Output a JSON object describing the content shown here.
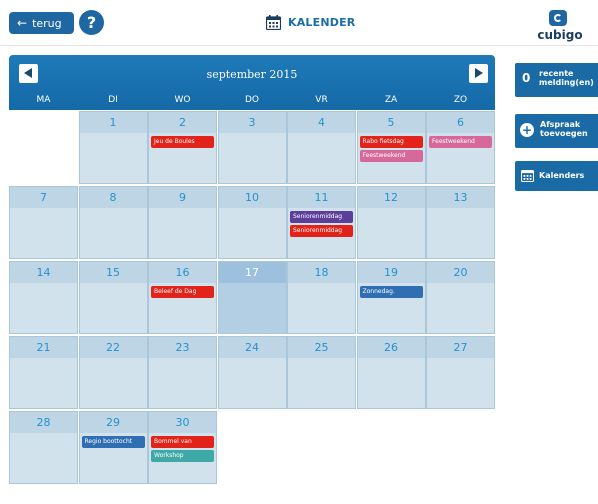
{
  "header": {
    "back_label": "terug",
    "help_label": "?",
    "title": "KALENDER",
    "logo_text": "cubigo"
  },
  "calendar": {
    "month_label": "september 2015",
    "day_names": [
      "MA",
      "DI",
      "WO",
      "DO",
      "VR",
      "ZA",
      "ZO"
    ],
    "today": 17,
    "weeks": [
      [
        null,
        {
          "day": 1
        },
        {
          "day": 2,
          "events": [
            {
              "label": "Jeu de Boules",
              "color": "#e2231a"
            }
          ]
        },
        {
          "day": 3
        },
        {
          "day": 4
        },
        {
          "day": 5,
          "events": [
            {
              "label": "Rabo fietsdag",
              "color": "#e2231a"
            },
            {
              "label": "Feestweekend",
              "color": "#d6699a"
            }
          ]
        },
        {
          "day": 6,
          "events": [
            {
              "label": "Feestweekend",
              "color": "#d6699a"
            }
          ]
        }
      ],
      [
        {
          "day": 7
        },
        {
          "day": 8
        },
        {
          "day": 9
        },
        {
          "day": 10
        },
        {
          "day": 11,
          "events": [
            {
              "label": "Seniorenmiddag",
              "color": "#5b3f9a"
            },
            {
              "label": "Seniorenmiddag",
              "color": "#e2231a"
            }
          ]
        },
        {
          "day": 12
        },
        {
          "day": 13
        }
      ],
      [
        {
          "day": 14
        },
        {
          "day": 15
        },
        {
          "day": 16,
          "events": [
            {
              "label": "Beleef de Dag",
              "color": "#e2231a"
            }
          ]
        },
        {
          "day": 17
        },
        {
          "day": 18
        },
        {
          "day": 19,
          "events": [
            {
              "label": "Zonnedag.",
              "color": "#2f6eb3"
            }
          ]
        },
        {
          "day": 20
        }
      ],
      [
        {
          "day": 21
        },
        {
          "day": 22
        },
        {
          "day": 23
        },
        {
          "day": 24
        },
        {
          "day": 25
        },
        {
          "day": 26
        },
        {
          "day": 27
        }
      ],
      [
        {
          "day": 28
        },
        {
          "day": 29,
          "events": [
            {
              "label": "Regio boottocht",
              "color": "#2f6eb3"
            }
          ]
        },
        {
          "day": 30,
          "events": [
            {
              "label": "Bommel van",
              "color": "#e2231a"
            },
            {
              "label": "Workshop",
              "color": "#3fa9a8"
            }
          ]
        },
        null,
        null,
        null,
        null
      ]
    ]
  },
  "sidebar": {
    "notifications": {
      "count": "0",
      "label_line1": "recente",
      "label_line2": "melding(en)"
    },
    "add_appointment": {
      "label_line1": "Afspraak",
      "label_line2": "toevoegen"
    },
    "calendars": {
      "label": "Kalenders"
    }
  },
  "colors": {
    "accent": "#1e67a3",
    "header_bg": "#1569a7",
    "cell_bg": "#d2e2ed",
    "day_number": "#2592cf"
  }
}
